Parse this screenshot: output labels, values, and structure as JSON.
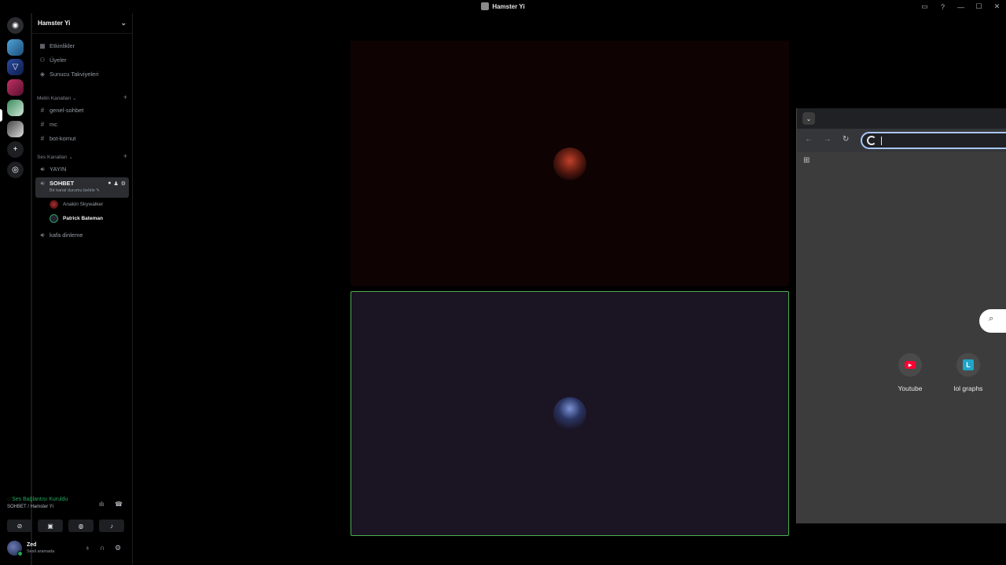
{
  "window": {
    "title": "Hamster Yi"
  },
  "guild": {
    "name": "Hamster Yi"
  },
  "nav": [
    {
      "label": "Etkinlikler",
      "icon": "calendar-icon"
    },
    {
      "label": "Üyeler",
      "icon": "members-icon"
    },
    {
      "label": "Sunucu Takviyeleri",
      "icon": "boost-icon"
    }
  ],
  "categories": {
    "text": "Metin Kanalları",
    "voice": "Ses Kanalları"
  },
  "text_channels": [
    "genel-sohbet",
    "mc",
    "bot-komut"
  ],
  "voice_channels": {
    "first": "YAYIN",
    "active": {
      "name": "SOHBET",
      "status": "Bir kanal durumu belirle"
    },
    "users": [
      {
        "name": "Anakin Skywalker",
        "speaking": false
      },
      {
        "name": "Patrick Bateman",
        "speaking": true
      }
    ],
    "last": "kafa dinleme"
  },
  "voice_panel": {
    "status": "Ses Bağlantısı Kuruldu",
    "channel": "SOHBET / Hamster Yi"
  },
  "user": {
    "name": "Zed",
    "status": "Sesli aramada"
  },
  "browser": {
    "omnibox_value": "",
    "shortcuts": [
      {
        "label": "Youtube",
        "icon": "youtube-icon"
      },
      {
        "label": "lol graphs",
        "icon": "lolgraphs-icon",
        "letter": "L"
      }
    ]
  },
  "colors": {
    "connected": "#23a55a",
    "speaking_border": "#4caf50",
    "omnibox_focus": "#a8c7fa"
  }
}
